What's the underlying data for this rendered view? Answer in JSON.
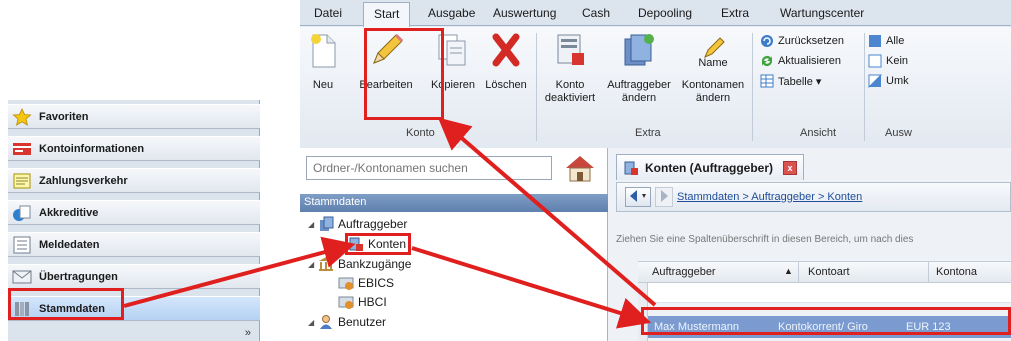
{
  "colors": {
    "accent_red": "#e0201e",
    "selection_blue": "#7b9bd0",
    "ribbon_bg": "#e9eef5"
  },
  "left_nav": {
    "items": [
      {
        "label": "Favoriten",
        "icon": "star-icon"
      },
      {
        "label": "Kontoinformationen",
        "icon": "account-info-icon"
      },
      {
        "label": "Zahlungsverkehr",
        "icon": "payments-icon"
      },
      {
        "label": "Akkreditive",
        "icon": "letter-of-credit-icon"
      },
      {
        "label": "Meldedaten",
        "icon": "report-data-icon"
      },
      {
        "label": "Übertragungen",
        "icon": "transfer-icon"
      },
      {
        "label": "Stammdaten",
        "icon": "master-data-icon"
      }
    ],
    "more_glyph": "»"
  },
  "ribbon": {
    "tabs": [
      "Datei",
      "Start",
      "Ausgabe",
      "Auswertung",
      "Cash",
      "Depooling",
      "Extra",
      "Wartungscenter"
    ],
    "active_tab": "Start",
    "konto_group": {
      "label": "Konto",
      "neu": "Neu",
      "bearbeiten": "Bearbeiten",
      "kopieren": "Kopieren",
      "loeschen": "Löschen"
    },
    "extra_group": {
      "label": "Extra",
      "konto_deaktiviert_1": "Konto",
      "konto_deaktiviert_2": "deaktiviert",
      "auftraggeber_aendern_1": "Auftraggeber",
      "auftraggeber_aendern_2": "ändern",
      "kontonamen_aendern_1": "Kontonamen",
      "kontonamen_aendern_2": "ändern",
      "name_icon_label": "Name"
    },
    "ansicht_group": {
      "label": "Ansicht",
      "zuruecksetzen": "Zurücksetzen",
      "aktualisieren": "Aktualisieren",
      "tabelle": "Tabelle ▾"
    },
    "ausw_group": {
      "label": "Ausw",
      "alle": "Alle",
      "kein": "Kein",
      "umk": "Umk"
    }
  },
  "tree": {
    "search_placeholder": "Ordner-/Kontonamen suchen",
    "header": "Stammdaten",
    "auftraggeber": "Auftraggeber",
    "konten": "Konten",
    "bankzugaenge": "Bankzugänge",
    "ebics": "EBICS",
    "hbci": "HBCI",
    "benutzer": "Benutzer"
  },
  "content": {
    "doc_tab_title": "Konten (Auftraggeber)",
    "doc_close": "x",
    "breadcrumb": "Stammdaten > Auftraggeber > Konten",
    "grouping_hint": "Ziehen Sie eine Spaltenüberschrift in diesen Bereich, um nach dies",
    "columns": [
      "Auftraggeber",
      "Kontoart",
      "Kontona"
    ],
    "row": {
      "auftraggeber": "Max Mustermann",
      "kontoart": "Kontokorrent/ Giro",
      "kontoname": "EUR 123"
    },
    "sort_glyph": "▲"
  }
}
